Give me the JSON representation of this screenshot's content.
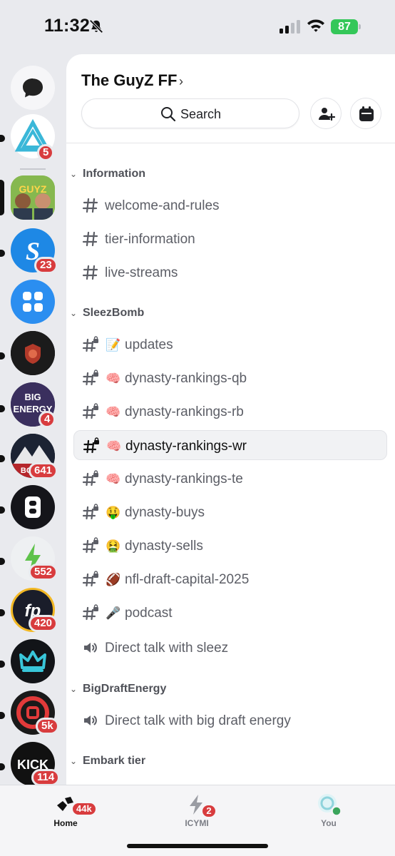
{
  "status": {
    "time": "11:32",
    "battery": "87"
  },
  "rail": {
    "badges": [
      "5",
      "23",
      "4",
      "641",
      "552",
      "420",
      "5k",
      "114"
    ]
  },
  "server": {
    "name": "The GuyZ FF"
  },
  "search": {
    "label": "Search"
  },
  "categories": {
    "information": "Information",
    "sleezbomb": "SleezBomb",
    "bigdraftenergy": "BigDraftEnergy",
    "embark": "Embark tier"
  },
  "channels": {
    "welcome": "welcome-and-rules",
    "tier_info": "tier-information",
    "live_streams": "live-streams",
    "updates": "updates",
    "rankings_qb": "dynasty-rankings-qb",
    "rankings_rb": "dynasty-rankings-rb",
    "rankings_wr": "dynasty-rankings-wr",
    "rankings_te": "dynasty-rankings-te",
    "buys": "dynasty-buys",
    "sells": "dynasty-sells",
    "draft_capital": "nfl-draft-capital-2025",
    "podcast": "podcast",
    "voice_sleez": "Direct talk with sleez",
    "voice_bde": "Direct talk with big draft energy"
  },
  "emojis": {
    "updates": "📝",
    "brain": "🧠",
    "buys": "🤑",
    "sells": "🤮",
    "football": "🏈",
    "mic": "🎤"
  },
  "nav": {
    "home_label": "Home",
    "home_badge": "44k",
    "icymi_label": "ICYMI",
    "icymi_badge": "2",
    "you_label": "You"
  },
  "colors": {
    "accent_red": "#d83c3e",
    "battery_green": "#34c759",
    "online_green": "#3ba55c"
  }
}
